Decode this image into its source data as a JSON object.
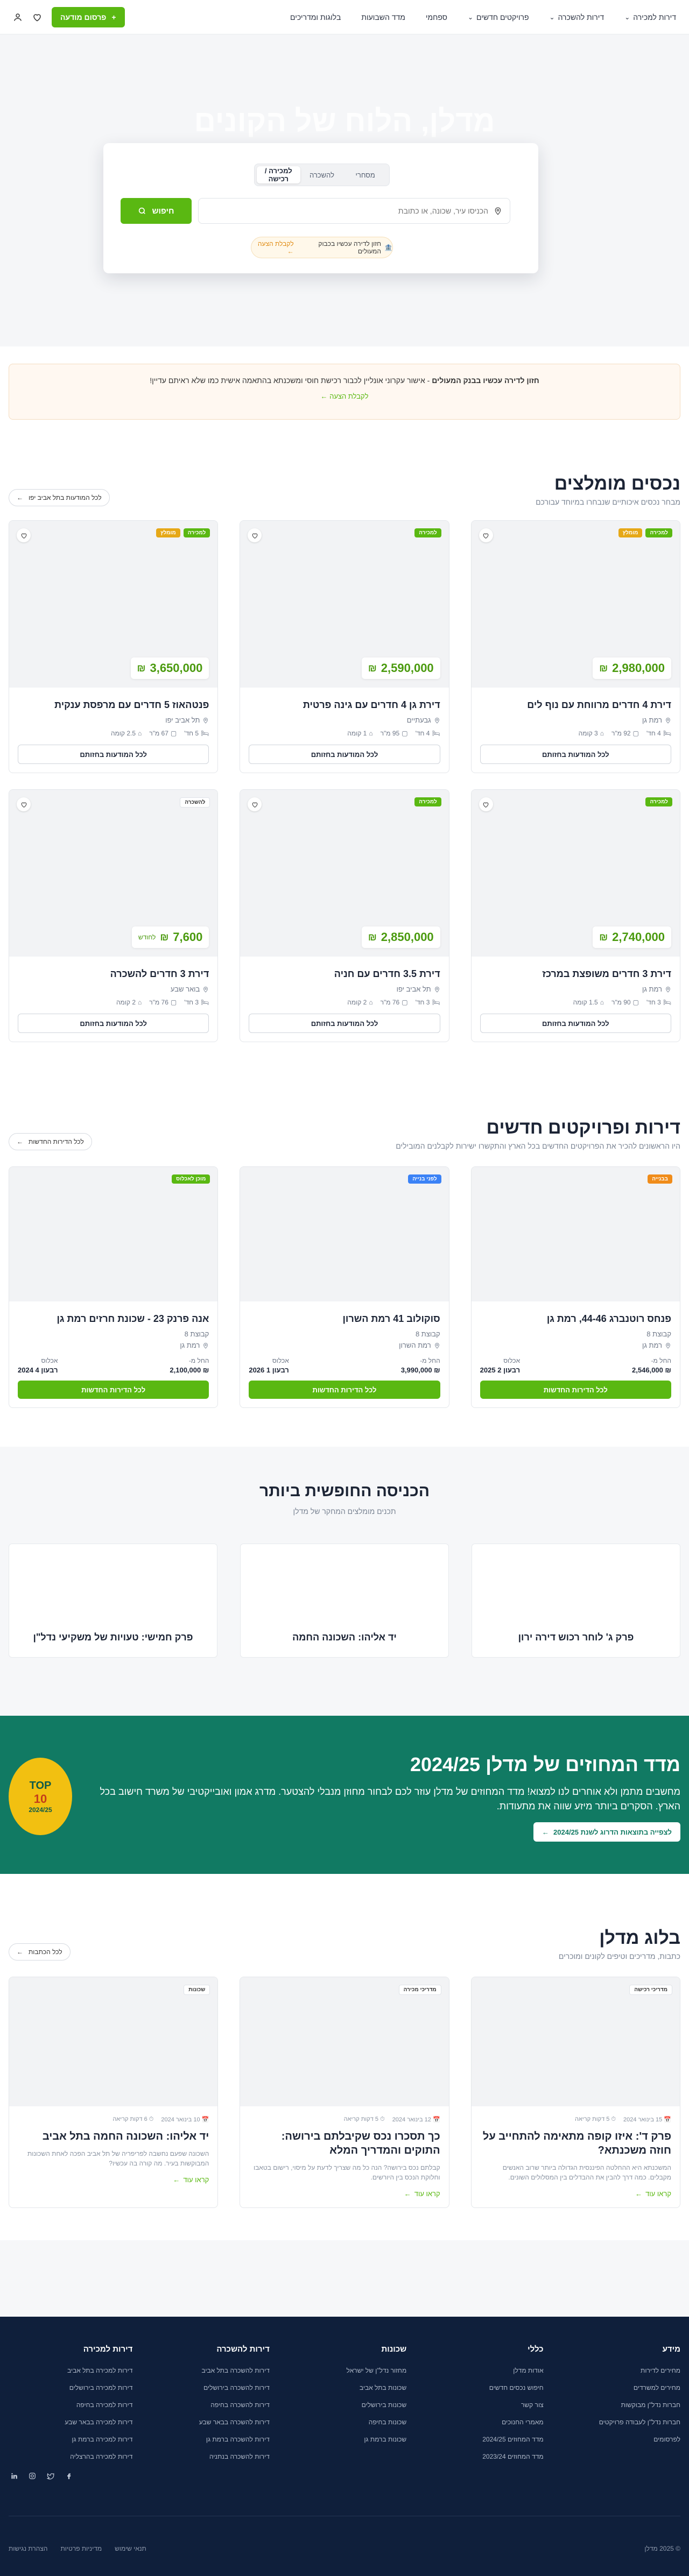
{
  "header": {
    "nav": [
      "דירות למכירה",
      "דירות להשכרה",
      "פרויקטים חדשים",
      "ספחמי",
      "מדד השבועות",
      "בלוגות ומדריכים"
    ],
    "nav_dropdown": [
      true,
      true,
      true,
      false,
      false,
      false
    ],
    "publish": "פרסום מודעה"
  },
  "hero": {
    "title": "מדלן, הלוח של הקונים",
    "tabs": [
      "למכירה / רכישה",
      "להשכרה",
      "מסחרי"
    ],
    "search_placeholder": "הכניסו עיר, שכונה, או כתובת",
    "search_button": "חיפוש",
    "pill_text": "חזון לדירה עכשיו בכבוק המעולים",
    "pill_link": "לקבלת הצעה ←"
  },
  "notice": {
    "bold": "חזון לדירה עכשיו בבנק המעולים",
    "text": " - אישור עקרוני אונליין לכבור רכישת חוסי ומשכנתא בהתאמה אישית כמו שלא ראיתם עדיין!",
    "link": "לקבלת הצעה ←"
  },
  "featured": {
    "title": "נכסים מומלצים",
    "subtitle": "מבחר נכסים איכותיים שנבחרו במיוחד עבורכם",
    "button": "לכל המודעות בתל אביב יפו",
    "card_button": "לכל המודעות בחזותם",
    "items": [
      {
        "title": "דירת 4 חדרים מרווחת עם נוף לים",
        "location": "רמת גן",
        "rooms": "4 חד'",
        "size": "92 מ\"ר",
        "floor": "3 קומה",
        "price": "2,980,000",
        "currency": "₪",
        "per_month": "",
        "badges": [
          {
            "t": "למכירה",
            "c": "b-green"
          },
          {
            "t": "מומלץ",
            "c": "b-amber"
          }
        ]
      },
      {
        "title": "דירת גן 4 חדרים עם גינה פרטית",
        "location": "גבעתיים",
        "rooms": "4 חד'",
        "size": "95 מ\"ר",
        "floor": "1 קומה",
        "price": "2,590,000",
        "currency": "₪",
        "per_month": "",
        "badges": [
          {
            "t": "למכירה",
            "c": "b-green"
          }
        ]
      },
      {
        "title": "פנטהאוז 5 חדרים עם מרפסת ענקית",
        "location": "תל אביב יפו",
        "rooms": "5 חד'",
        "size": "67 מ\"ר",
        "floor": "2.5 קומה",
        "price": "3,650,000",
        "currency": "₪",
        "per_month": "",
        "badges": [
          {
            "t": "למכירה",
            "c": "b-green"
          },
          {
            "t": "מומלץ",
            "c": "b-amber"
          }
        ]
      },
      {
        "title": "דירת 3 חדרים משופצת במרכז",
        "location": "רמת גן",
        "rooms": "3 חד'",
        "size": "90 מ\"ר",
        "floor": "1.5 קומה",
        "price": "2,740,000",
        "currency": "₪",
        "per_month": "",
        "badges": [
          {
            "t": "למכירה",
            "c": "b-green"
          }
        ]
      },
      {
        "title": "דירת 3.5 חדרים עם חניה",
        "location": "תל אביב יפו",
        "rooms": "3 חד'",
        "size": "76 מ\"ר",
        "floor": "2 קומה",
        "price": "2,850,000",
        "currency": "₪",
        "per_month": "",
        "badges": [
          {
            "t": "למכירה",
            "c": "b-green"
          }
        ]
      },
      {
        "title": "דירת 3 חדרים להשכרה",
        "location": "בואר שבע",
        "rooms": "3 חד'",
        "size": "76 מ\"ר",
        "floor": "2 קומה",
        "price": "7,600",
        "currency": "₪",
        "per_month": "לחודש",
        "badges": [
          {
            "t": "להשכרה",
            "c": "b-white"
          }
        ]
      }
    ]
  },
  "projects": {
    "title": "דירות ופרויקטים חדשים",
    "subtitle": "היו הראשונים להכיר את הפרויקטים החדשים בכל הארץ והתקשרו ישירות לקבלנים המובילים",
    "button": "לכל הדירות החדשות",
    "card_button": "לכל הדירות החדשות",
    "units_label": "דירות",
    "occupancy_label": "אכלוס",
    "price_label": "החל מ-",
    "items": [
      {
        "title": "פנחס רוטנברג 44-46, רמת גן",
        "builder": "קבוצת 8",
        "location": "רמת גן",
        "price": "₪ 2,546,000",
        "occupancy": "רבעון 2 2025",
        "badge": {
          "t": "בבנייה",
          "c": "b-orange"
        }
      },
      {
        "title": "סוקולוב 41 רמת השרון",
        "builder": "קבוצת 8",
        "location": "רמת השרון",
        "price": "₪ 3,990,000",
        "occupancy": "רבעון 1 2026",
        "badge": {
          "t": "לפני בנייה",
          "c": "b-blue"
        }
      },
      {
        "title": "אנה פרנק 23 - שכונת חרזים רמת גן",
        "builder": "קבוצת 8",
        "location": "רמת גן",
        "price": "₪ 2,100,000",
        "occupancy": "רבעון 4 2024",
        "badge": {
          "t": "מוכן לאכלוס",
          "c": "b-green"
        }
      }
    ]
  },
  "popular": {
    "title": "הכניסה החופשית ביותר",
    "subtitle": "תכנים מומלצים המחקר של מדלן",
    "items": [
      "פרק ג' לוחר רכוש דירה ירון",
      "יד אליהו: השכונה החמה",
      "פרק חמישי: טעויות של משקיעי נדל\"ן"
    ]
  },
  "index": {
    "title": "מדד המחוזים של מדלן 2024/25",
    "text": "מחשבים מתמן ולא אוחרים לנו למצוא! מדד המחוזים של מדלן עוזר לכם לבחור מחוזן מנבלי להצטער. מדרג אמון ואובייקטיבי של משרד חישוב בכל הארץ. הסקרים ביותר מיזע שווה את מתעודות.",
    "button": "לצפייה בתוצאות הדרוג לשנת 2024/25",
    "seal_top": "TOP",
    "seal_mid": "10",
    "seal_year": "2024/25"
  },
  "blog": {
    "title": "בלוג מדלן",
    "subtitle": "כתבות, מדריכים וטיפים לקונים ומוכרים",
    "button": "לכל הכתבות",
    "read_more": "קראו עוד",
    "items": [
      {
        "tag": "מדריכי רכישה",
        "date": "15 בינואר 2024",
        "read": "5 דקות קריאה",
        "title": "פרק ד': איזו קופה מתאימה להתחייב על חוזה משכנתא?",
        "excerpt": "המשכנתא היא ההחלטה הפיננסית הגדולה ביותר שרוב האנשים מקבלים. כמה דרך להבין את ההבדלים בין המסלולים השונים."
      },
      {
        "tag": "מדריכי מכירה",
        "date": "12 בינואר 2024",
        "read": "5 דקות קריאה",
        "title": "כך תסכרו נכס שקיבלתם בירושה: התוקים והמדריך המלא",
        "excerpt": "קבלתם נכס בירושה? הנה כל מה שצריך לדעת על מיסוי, רישום בטאבו וחלוקת הנכס בין היורשים."
      },
      {
        "tag": "שכונות",
        "date": "10 בינואר 2024",
        "read": "6 דקות קריאה",
        "title": "יד אליהו: השכונה החמה בתל אביב",
        "excerpt": "השכונה שפעם נחשבה לפריפריה של תל אביב הפכה לאחת השכונות המבוקשות בעיר. מה קורה בה עכשיו?"
      }
    ]
  },
  "footer": {
    "columns": [
      {
        "title": "מידע",
        "links": [
          "מחירים לדירות",
          "מחירים למשרדים",
          "חברות נדל\"ן מבוקשות",
          "חברות נדל\"ן לעבודה פרויקטים",
          "לפרסומים"
        ]
      },
      {
        "title": "כללי",
        "links": [
          "אודות מדלן",
          "חיפוש נכסים חדשים",
          "צור קשר",
          "מאמרי החנוכים",
          "מדד המחוזים 2024/25",
          "מדד המחוזים 2023/24"
        ]
      },
      {
        "title": "שכונות",
        "links": [
          "מחזור נדל\"ן של ישראל",
          "שכונות בתל אביב",
          "שכונות בירושלים",
          "שכונות בחיפה",
          "שכונות ברמת גן"
        ]
      },
      {
        "title": "דירות להשכרה",
        "links": [
          "דירות להשכרה בתל אביב",
          "דירות להשכרה בירושלים",
          "דירות להשכרה בחיפה",
          "דירות להשכרה בבאר שבע",
          "דירות להשכרה ברמת גן",
          "דירות להשכרה בנתניה"
        ]
      },
      {
        "title": "דירות למכירה",
        "links": [
          "דירות למכירה בתל אביב",
          "דירות למכירה בירושלים",
          "דירות למכירה בחיפה",
          "דירות למכירה בבאר שבע",
          "דירות למכירה ברמת גן",
          "דירות למכירה בהרצליה"
        ]
      }
    ],
    "copyright": "© 2025 מדלן",
    "bottom_links": [
      "תנאי שימוש",
      "מדיניות פרטיות",
      "הצהרת נגישות"
    ]
  }
}
